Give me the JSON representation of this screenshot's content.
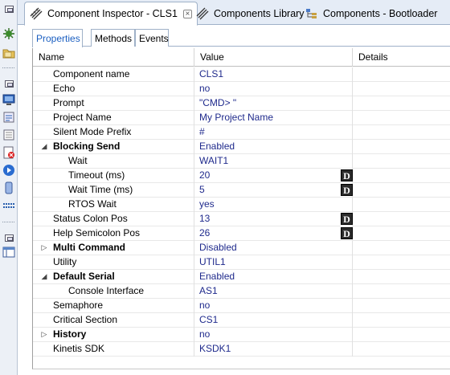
{
  "editor_tabs": [
    {
      "label": "Component Inspector - CLS1",
      "active": true,
      "closable": true,
      "icon": "component-inspector-icon"
    },
    {
      "label": "Components Library",
      "active": false,
      "icon": "components-library-icon"
    },
    {
      "label": "Components - Bootloader",
      "active": false,
      "icon": "components-tree-icon"
    }
  ],
  "sub_tabs": [
    {
      "label": "Properties",
      "active": true
    },
    {
      "label": "Methods",
      "active": false
    },
    {
      "label": "Events",
      "active": false
    }
  ],
  "columns": {
    "name": "Name",
    "value": "Value",
    "details": "Details"
  },
  "rows": [
    {
      "name": "Component name",
      "value": "CLS1",
      "level": 1,
      "bold": false,
      "expander": "none",
      "dbtn": false
    },
    {
      "name": "Echo",
      "value": "no",
      "level": 1,
      "bold": false,
      "expander": "none",
      "dbtn": false
    },
    {
      "name": "Prompt",
      "value": "\"CMD> \"",
      "level": 1,
      "bold": false,
      "expander": "none",
      "dbtn": false
    },
    {
      "name": "Project Name",
      "value": "My Project Name",
      "level": 1,
      "bold": false,
      "expander": "none",
      "dbtn": false
    },
    {
      "name": "Silent Mode Prefix",
      "value": "#",
      "level": 1,
      "bold": false,
      "expander": "none",
      "dbtn": false
    },
    {
      "name": "Blocking Send",
      "value": "Enabled",
      "level": 1,
      "bold": true,
      "expander": "expanded",
      "dbtn": false
    },
    {
      "name": "Wait",
      "value": "WAIT1",
      "level": 2,
      "bold": false,
      "expander": "none",
      "dbtn": false
    },
    {
      "name": "Timeout (ms)",
      "value": "20",
      "level": 2,
      "bold": false,
      "expander": "none",
      "dbtn": true
    },
    {
      "name": "Wait Time (ms)",
      "value": "5",
      "level": 2,
      "bold": false,
      "expander": "none",
      "dbtn": true
    },
    {
      "name": "RTOS Wait",
      "value": "yes",
      "level": 2,
      "bold": false,
      "expander": "none",
      "dbtn": false
    },
    {
      "name": "Status Colon Pos",
      "value": "13",
      "level": 1,
      "bold": false,
      "expander": "none",
      "dbtn": true
    },
    {
      "name": "Help Semicolon Pos",
      "value": "26",
      "level": 1,
      "bold": false,
      "expander": "none",
      "dbtn": true
    },
    {
      "name": "Multi Command",
      "value": "Disabled",
      "level": 1,
      "bold": true,
      "expander": "collapsed",
      "dbtn": false
    },
    {
      "name": "Utility",
      "value": "UTIL1",
      "level": 1,
      "bold": false,
      "expander": "none",
      "dbtn": false
    },
    {
      "name": "Default Serial",
      "value": "Enabled",
      "level": 1,
      "bold": true,
      "expander": "expanded",
      "dbtn": false
    },
    {
      "name": "Console Interface",
      "value": "AS1",
      "level": 2,
      "bold": false,
      "expander": "none",
      "dbtn": false
    },
    {
      "name": "Semaphore",
      "value": "no",
      "level": 1,
      "bold": false,
      "expander": "none",
      "dbtn": false
    },
    {
      "name": "Critical Section",
      "value": "CS1",
      "level": 1,
      "bold": false,
      "expander": "none",
      "dbtn": false
    },
    {
      "name": "History",
      "value": "no",
      "level": 1,
      "bold": true,
      "expander": "collapsed",
      "dbtn": false
    },
    {
      "name": "Kinetis SDK",
      "value": "KSDK1",
      "level": 1,
      "bold": false,
      "expander": "none",
      "dbtn": false
    }
  ],
  "dbutton_label": "D",
  "icons": {
    "expanded": "◢",
    "collapsed": "▷",
    "close": "×"
  },
  "sidebar_icons": [
    "minimize-icon",
    "debug-icon",
    "folder-icon",
    "minimize-icon",
    "monitor-icon",
    "debug-view-icon",
    "list-icon",
    "error-log-icon",
    "run-icon",
    "memory-icon",
    "registers-icon",
    "minimize-icon",
    "layout-icon"
  ],
  "colors": {
    "value_text": "#1f2a8c",
    "active_subtab": "#1b5fc1",
    "tab_bar": "#e5ecf6"
  }
}
